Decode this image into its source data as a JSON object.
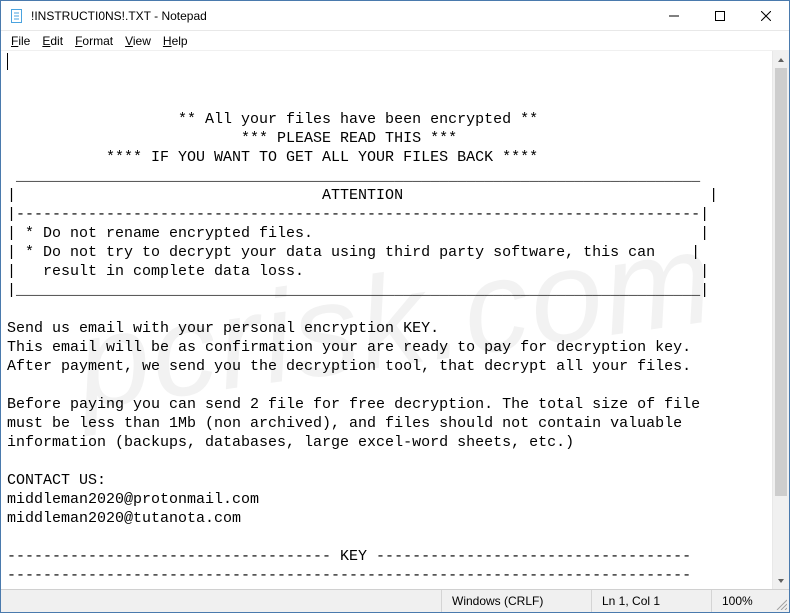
{
  "titlebar": {
    "title": "!INSTRUCTI0NS!.TXT - Notepad",
    "icon": "notepad-icon"
  },
  "window_controls": {
    "minimize": "minimize",
    "maximize": "maximize",
    "close": "close"
  },
  "menubar": {
    "file": "File",
    "edit": "Edit",
    "format": "Format",
    "view": "View",
    "help": "Help"
  },
  "document": {
    "lines": [
      "                   ** All your files have been encrypted **",
      "                          *** PLEASE READ THIS ***",
      "           **** IF YOU WANT TO GET ALL YOUR FILES BACK ****",
      " ____________________________________________________________________________",
      "|                                  ATTENTION                                  |",
      "|----------------------------------------------------------------------------|",
      "| * Do not rename encrypted files.                                           |",
      "| * Do not try to decrypt your data using third party software, this can    |",
      "|   result in complete data loss.                                            |",
      "|____________________________________________________________________________|",
      "",
      "Send us email with your personal encryption KEY.",
      "This email will be as confirmation your are ready to pay for decryption key.",
      "After payment, we send you the decryption tool, that decrypt all your files.",
      "",
      "Before paying you can send 2 file for free decryption. The total size of file",
      "must be less than 1Mb (non archived), and files should not contain valuable",
      "information (backups, databases, large excel-word sheets, etc.)",
      "",
      "CONTACT US:",
      "middleman2020@protonmail.com",
      "middleman2020@tutanota.com",
      "",
      "------------------------------------ KEY -----------------------------------",
      "----------------------------------------------------------------------------"
    ]
  },
  "statusbar": {
    "encoding_line": "Windows (CRLF)",
    "position": "Ln 1, Col 1",
    "zoom": "100%"
  }
}
